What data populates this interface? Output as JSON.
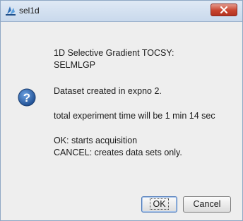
{
  "window": {
    "title": "sel1d",
    "close_icon": "close-icon"
  },
  "message": {
    "icon": "question-icon",
    "line1": "1D Selective Gradient TOCSY:",
    "line2": "SELMLGP",
    "line3": "Dataset created in expno 2.",
    "line4": "total experiment time will be 1 min 14 sec",
    "line5": "OK: starts acquisition",
    "line6": "CANCEL: creates data sets only."
  },
  "buttons": {
    "ok_label": "OK",
    "cancel_label": "Cancel"
  },
  "colors": {
    "close_button": "#c8432e",
    "question_icon": "#2a5fa6"
  }
}
